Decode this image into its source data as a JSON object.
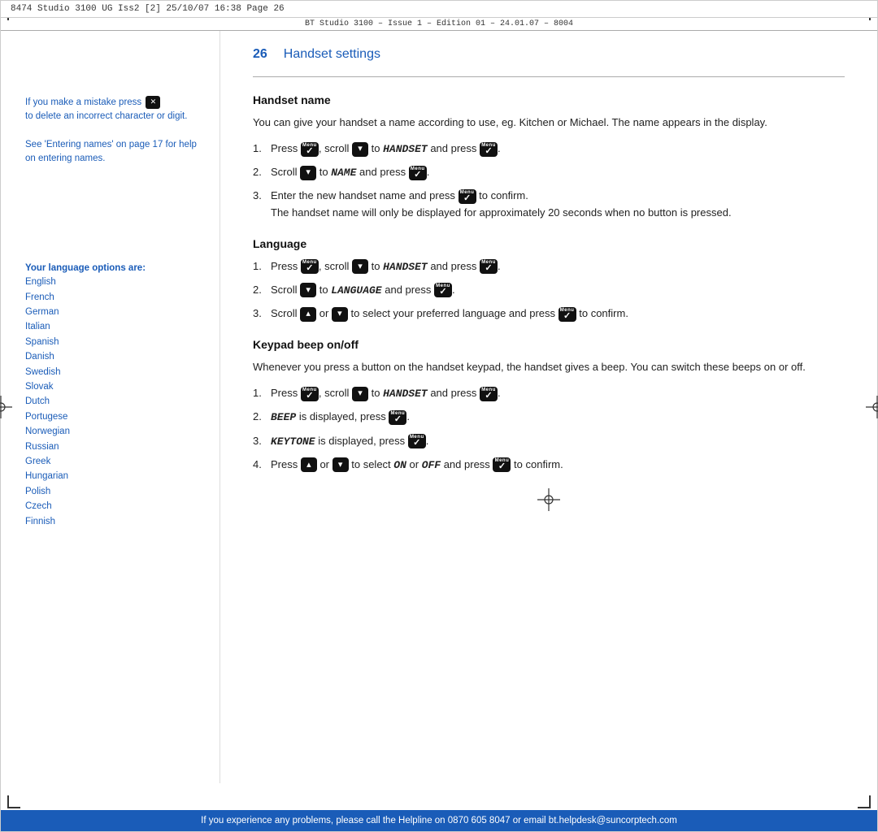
{
  "topBar": {
    "printInfo": "8474  Studio 3100  UG  Iss2  [2]   25/10/07   16:38   Page 26",
    "subInfo": "BT Studio 3100 – Issue 1 – Edition 01 – 24.01.07 – 8004"
  },
  "page": {
    "number": "26",
    "title": "Handset settings"
  },
  "sidebar": {
    "tipText": "If you make a mistake press",
    "tipText2": "to delete an incorrect character or digit.",
    "tipLink": "See 'Entering names' on page 17 for help on entering names.",
    "languageTitle": "Your language options are:",
    "languages": [
      "English",
      "French",
      "German",
      "Italian",
      "Spanish",
      "Danish",
      "Swedish",
      "Slovak",
      "Dutch",
      "Portugese",
      "Norwegian",
      "Russian",
      "Greek",
      "Hungarian",
      "Polish",
      "Czech",
      "Finnish"
    ]
  },
  "handsetName": {
    "heading": "Handset name",
    "para": "You can give your handset a name according to use, eg. Kitchen or Michael. The name appears in the display.",
    "steps": [
      {
        "num": "1.",
        "text": "Press",
        "part2": ", scroll",
        "part3": "to",
        "display": "HANDSET",
        "part4": "and press",
        "part5": "."
      },
      {
        "num": "2.",
        "text": "Scroll",
        "part2": "to",
        "display": "NAME",
        "part3": "and press",
        "part4": "."
      },
      {
        "num": "3.",
        "text": "Enter the new handset name and press",
        "part2": "to confirm. The handset name will only be displayed for approximately 20 seconds when no button is pressed."
      }
    ]
  },
  "language": {
    "heading": "Language",
    "steps": [
      {
        "num": "1.",
        "text": "Press",
        "part2": ", scroll",
        "part3": "to",
        "display": "HANDSET",
        "part4": "and press",
        "part5": "."
      },
      {
        "num": "2.",
        "text": "Scroll",
        "part2": "to",
        "display": "LANGUAGE",
        "part3": "and press",
        "part4": "."
      },
      {
        "num": "3.",
        "text": "Scroll",
        "part2": "or",
        "part3": "to select your preferred language and press",
        "part4": "to confirm."
      }
    ]
  },
  "keypadBeep": {
    "heading": "Keypad beep on/off",
    "para": "Whenever you press a button on the handset keypad, the handset gives a beep. You can switch these beeps on or off.",
    "steps": [
      {
        "num": "1.",
        "text": "Press",
        "part2": ", scroll",
        "part3": "to",
        "display": "HANDSET",
        "part4": "and press",
        "part5": "."
      },
      {
        "num": "2.",
        "display": "BEEP",
        "text": "is displayed, press",
        "part2": "."
      },
      {
        "num": "3.",
        "display": "KEYTONE",
        "text": "is displayed, press",
        "part2": "."
      },
      {
        "num": "4.",
        "text": "Press",
        "part2": "or",
        "part3": "to select",
        "display": "ON",
        "part4": "or",
        "display2": "OFF",
        "part5": "and press",
        "part6": "to confirm."
      }
    ]
  },
  "footer": {
    "text": "If you experience any problems, please call the Helpline on 0870 605 8047 or email bt.helpdesk@suncorptech.com"
  }
}
